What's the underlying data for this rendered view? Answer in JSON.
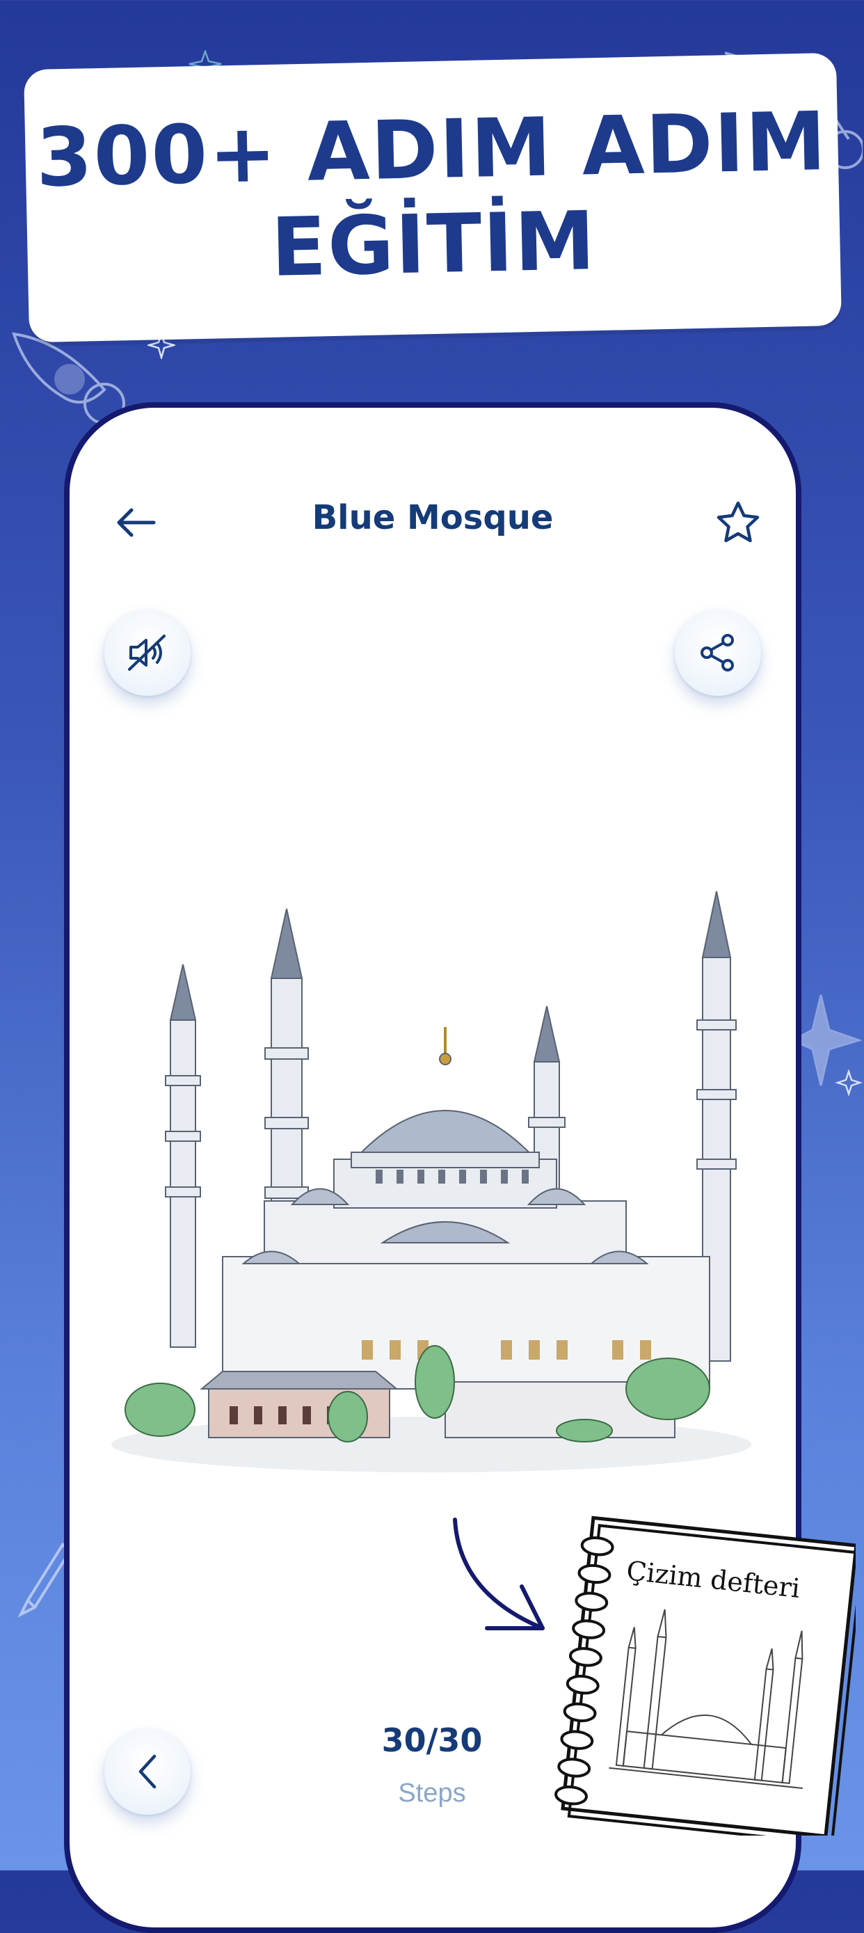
{
  "banner": {
    "line1": "300+ ADIM ADIM",
    "line2": "EĞİTİM"
  },
  "topbar": {
    "title": "Blue Mosque",
    "back_icon": "arrow-left-icon",
    "favorite_icon": "star-outline-icon"
  },
  "controls": {
    "sound_icon": "sound-off-icon",
    "share_icon": "share-icon",
    "prev_icon": "chevron-left-icon"
  },
  "steps": {
    "count": "30/30",
    "label": "Steps"
  },
  "notebook": {
    "title": "Çizim defteri"
  },
  "colors": {
    "brand_dark": "#1d3a8c",
    "title_text": "#153b78",
    "steps_label": "#8aa6c8",
    "phone_border": "#151a6e"
  }
}
